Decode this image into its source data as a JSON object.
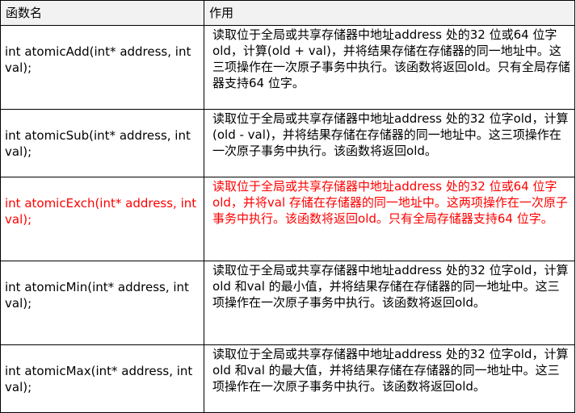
{
  "header": {
    "name_label": "函数名",
    "use_label": "作用"
  },
  "colors": {
    "highlight_text": "#ff0000",
    "header_bg": "#f2f2f2"
  },
  "rows": [
    {
      "name": "int atomicAdd(int* address, int val);",
      "description": "读取位于全局或共享存储器中地址address 处的32 位或64 位字old，计算(old + val)，并将结果存储在存储器的同一地址中。这三项操作在一次原子事务中执行。该函数将返回old。只有全局存储器支持64 位字。",
      "highlighted": false
    },
    {
      "name": "int atomicSub(int* address, int val);",
      "description": "读取位于全局或共享存储器中地址address 处的32 位字old，计算(old - val)，并将结果存储在存储器的同一地址中。这三项操作在一次原子事务中执行。该函数将返回old。",
      "highlighted": false
    },
    {
      "name": "int atomicExch(int* address, int val);",
      "description": "读取位于全局或共享存储器中地址address 处的32 位或64 位字old，并将val 存储在存储器的同一地址中。这两项操作在一次原子事务中执行。该函数将返回old。只有全局存储器支持64 位字。",
      "highlighted": true
    },
    {
      "name": "int atomicMin(int* address, int val);",
      "description": "读取位于全局或共享存储器中地址address 处的32 位字old，计算old 和val 的最小值，并将结果存储在存储器的同一地址中。这三项操作在一次原子事务中执行。该函数将返回old。",
      "highlighted": false
    },
    {
      "name": "int atomicMax(int* address, int val);",
      "description": "读取位于全局或共享存储器中地址address 处的32 位字old，计算old 和val 的最大值，并将结果存储在存储器的同一地址中。这三项操作在一次原子事务中执行。该函数将返回old。",
      "highlighted": false
    }
  ]
}
